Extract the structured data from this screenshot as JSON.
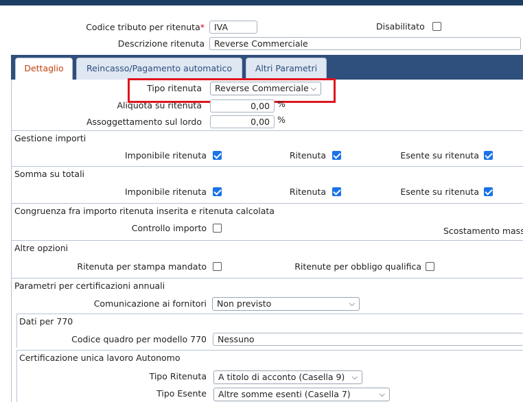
{
  "header": {
    "codice_label": "Codice tributo per ritenuta",
    "required_mark": "*",
    "codice_value": "IVA",
    "disabilitato_label": "Disabilitato",
    "disabilitato_checked": false,
    "descrizione_label": "Descrizione ritenuta",
    "descrizione_value": "Reverse Commerciale"
  },
  "tabs": [
    {
      "label": "Dettaglio",
      "active": true
    },
    {
      "label": "Reincasso/Pagamento automatico",
      "active": false
    },
    {
      "label": "Altri Parametri",
      "active": false
    }
  ],
  "dettaglio": {
    "tipo_ritenuta_label": "Tipo ritenuta",
    "tipo_ritenuta_value": "Reverse Commerciale",
    "aliquota_label": "Aliquota su ritenuta",
    "aliquota_value": "0,00",
    "aliquota_unit": "%",
    "assoggettamento_label": "Assoggettamento sul lordo",
    "assoggettamento_value": "0,00",
    "assoggettamento_unit": "%"
  },
  "gestione_importi": {
    "title": "Gestione importi",
    "imponibile_label": "Imponibile ritenuta",
    "ritenuta_label": "Ritenuta",
    "esente_label": "Esente su ritenuta"
  },
  "somma_totali": {
    "title": "Somma su totali",
    "imponibile_label": "Imponibile ritenuta",
    "ritenuta_label": "Ritenuta",
    "esente_label": "Esente su ritenuta"
  },
  "congruenza": {
    "title": "Congruenza fra importo ritenuta inserita e ritenuta calcolata",
    "controllo_label": "Controllo importo",
    "scostamento_label": "Scostamento mass"
  },
  "altre_opzioni": {
    "title": "Altre opzioni",
    "stampa_label": "Ritenuta per stampa mandato",
    "obbligo_label": "Ritenute per obbligo qualifica"
  },
  "certificazioni": {
    "title": "Parametri per certificazioni annuali",
    "comunicazione_label": "Comunicazione ai fornitori",
    "comunicazione_value": "Non previsto"
  },
  "dati_770": {
    "title": "Dati per 770",
    "codice_quadro_label": "Codice quadro per modello 770",
    "codice_quadro_value": "Nessuno"
  },
  "certificazione_unica": {
    "title": "Certificazione unica lavoro Autonomo",
    "tipo_ritenuta_label": "Tipo Ritenuta",
    "tipo_ritenuta_value": "A titolo di acconto (Casella 9)",
    "tipo_esente_label": "Tipo Esente",
    "tipo_esente_value": "Altre somme esenti (Casella 7)"
  },
  "icons": {
    "chevron": "chevron-down-icon",
    "check": "checkbox-checked-icon"
  },
  "colors": {
    "topbar": "#1f3e63",
    "tabstrip": "#2f4f7c",
    "active_tab_text": "#c2410c",
    "checkbox_on": "#1a73e8",
    "highlight": "#e0141d"
  }
}
